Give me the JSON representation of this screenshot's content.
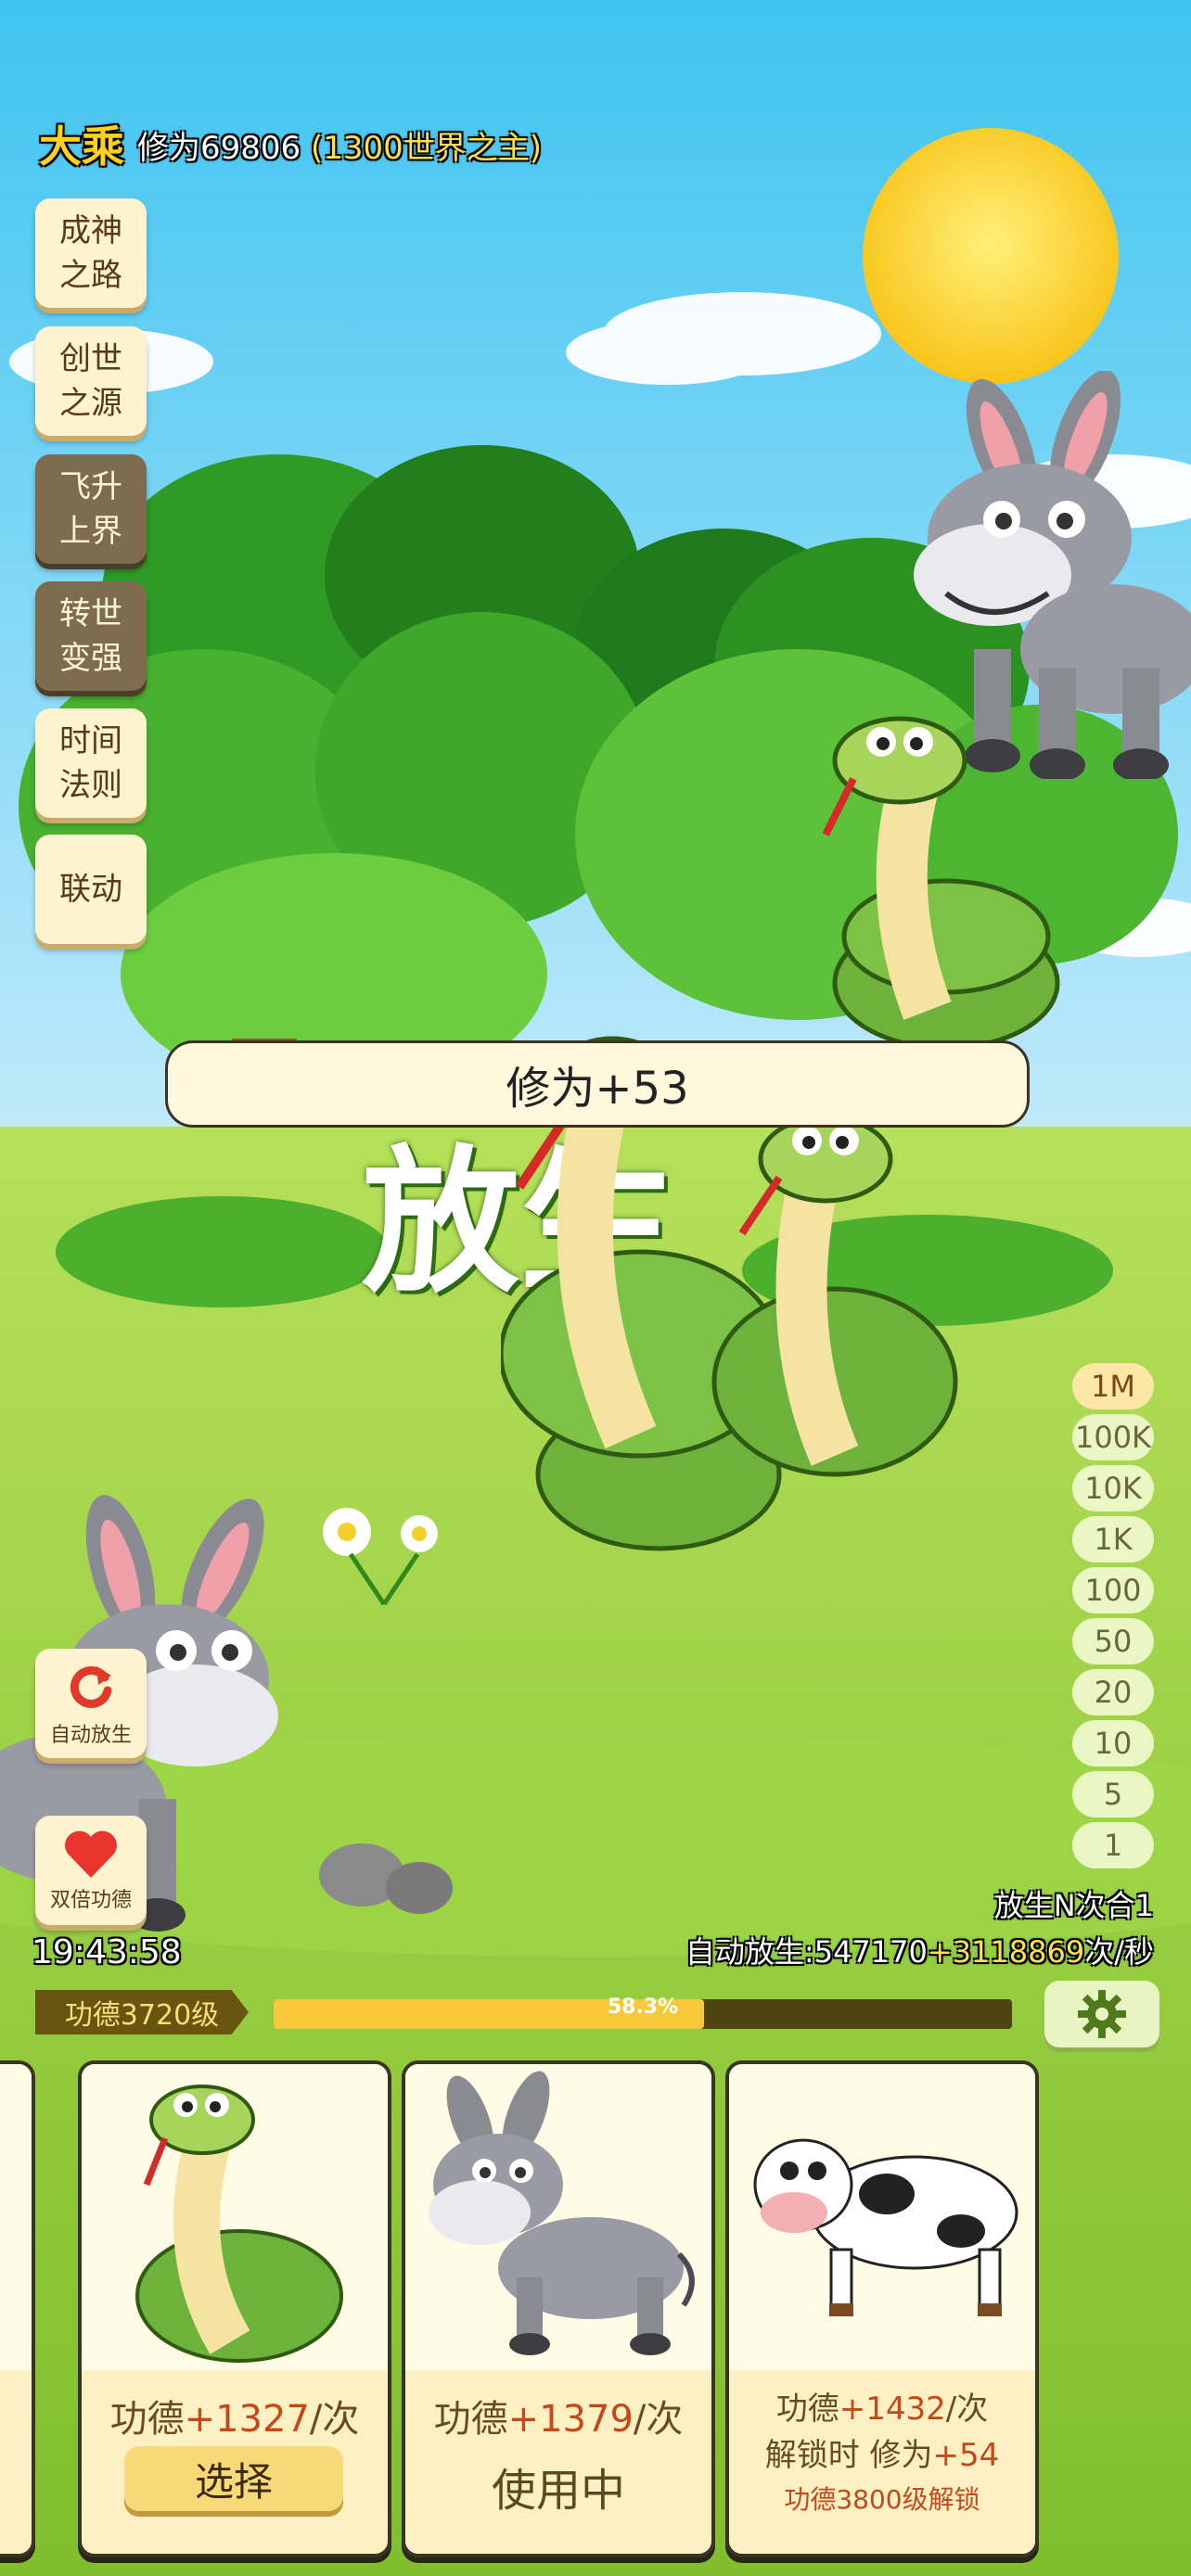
{
  "header": {
    "realm": "大乘",
    "cultivation_prefix": "修为69806",
    "cultivation_title": "(1300世界之主)"
  },
  "side_menu": [
    {
      "label": "成神\n之路",
      "style": "light"
    },
    {
      "label": "创世\n之源",
      "style": "light"
    },
    {
      "label": "飞升\n上界",
      "style": "dark"
    },
    {
      "label": "转世\n变强",
      "style": "dark"
    },
    {
      "label": "时间\n法则",
      "style": "light"
    },
    {
      "label": "联动",
      "style": "light"
    }
  ],
  "toast": {
    "text": "修为+53"
  },
  "background_title": "放生",
  "multipliers": {
    "options": [
      "1M",
      "100K",
      "10K",
      "1K",
      "100",
      "50",
      "20",
      "10",
      "5",
      "1"
    ],
    "selected": "1M"
  },
  "buttons": {
    "auto_release": "自动放生",
    "double_merit": "双倍功德"
  },
  "clock": "19:43:58",
  "stats": {
    "combine": "放生N次合1",
    "auto_prefix": "自动放生:547170",
    "auto_bonus": "+3118869",
    "auto_suffix": "次/秒"
  },
  "merit": {
    "level_label": "功德3720级",
    "progress_text": "58.3%",
    "progress": 0.583
  },
  "cards": [
    {
      "animal": "snake",
      "merit_prefix": "功德",
      "merit_value": "+1327",
      "merit_suffix": "/次",
      "action": "选择"
    },
    {
      "animal": "donkey",
      "merit_prefix": "功德",
      "merit_value": "+1379",
      "merit_suffix": "/次",
      "status": "使用中"
    },
    {
      "animal": "cow",
      "merit_prefix": "功德",
      "merit_value": "+1432",
      "merit_suffix": "/次",
      "unlock_prefix": "解锁时 修为",
      "unlock_value": "+54",
      "unlock_req": "功德3800级解锁"
    }
  ],
  "colors": {
    "sky": "#46c8ef",
    "grass": "#93d23b",
    "accent_gold": "#ffd21a",
    "merit_red": "#c4481a"
  }
}
